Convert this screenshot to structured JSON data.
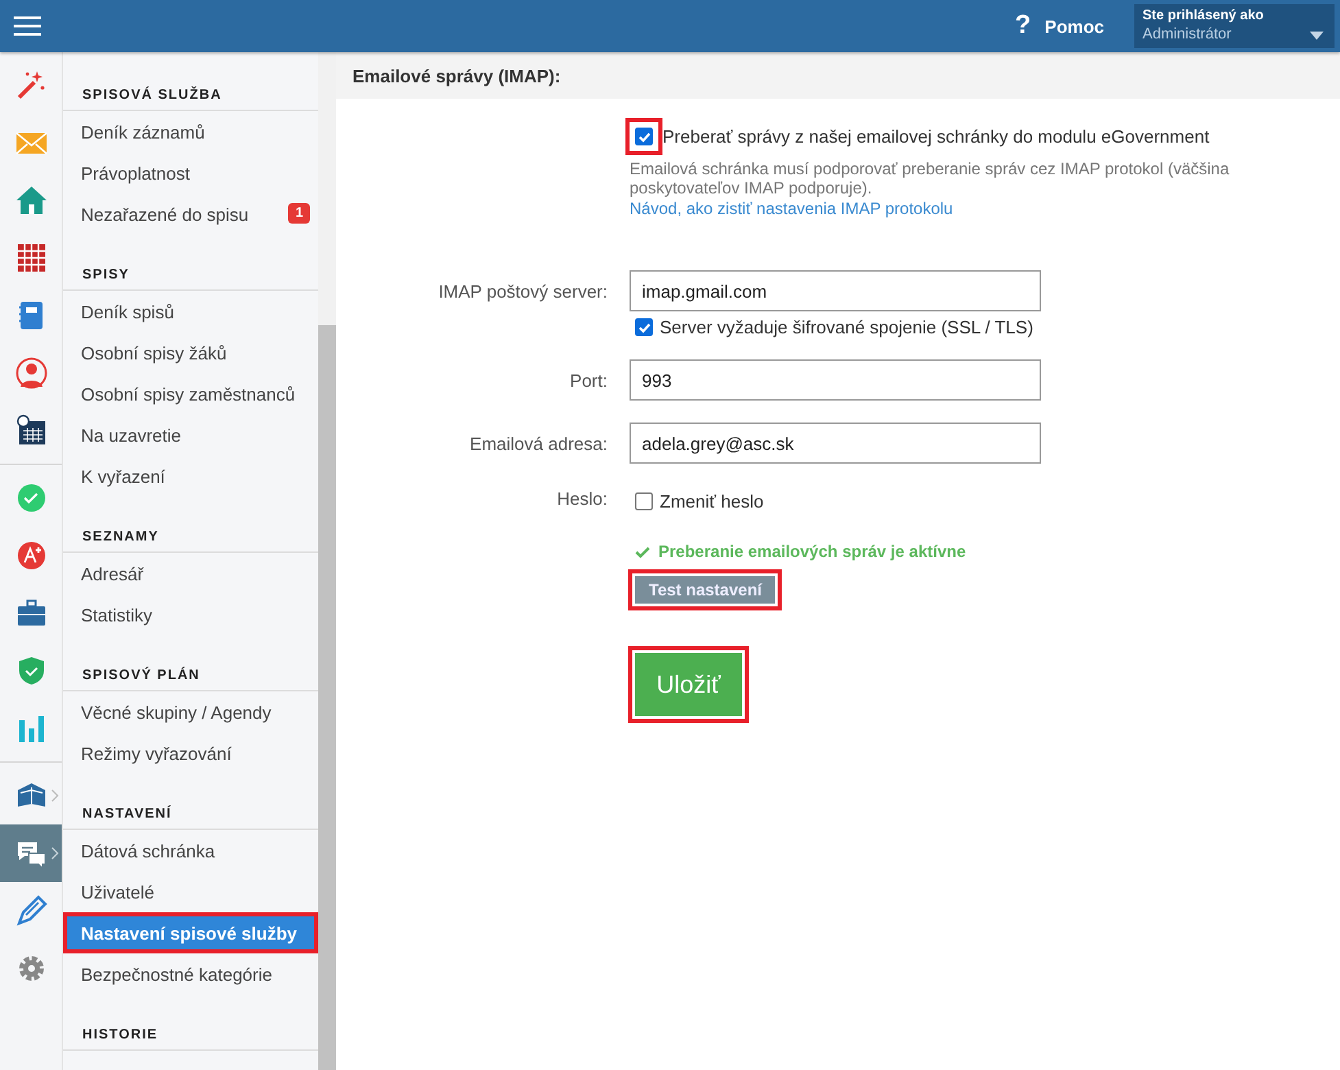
{
  "topbar": {
    "help_icon": "?",
    "help": "Pomoc",
    "user_caption": "Ste prihlásený ako",
    "user_role": "Administrátor"
  },
  "rail": {
    "groups": [
      [
        {
          "selected": false,
          "submenu": false
        },
        {
          "selected": false,
          "submenu": false
        },
        {
          "selected": false,
          "submenu": false
        },
        {
          "selected": false,
          "submenu": false
        },
        {
          "selected": false,
          "submenu": false
        },
        {
          "selected": false,
          "submenu": false
        },
        {
          "selected": false,
          "submenu": false
        }
      ],
      [
        {
          "selected": false,
          "submenu": false
        },
        {
          "selected": false,
          "submenu": false
        },
        {
          "selected": false,
          "submenu": false
        },
        {
          "selected": false,
          "submenu": false
        },
        {
          "selected": false,
          "submenu": false
        }
      ],
      [
        {
          "selected": false,
          "submenu": true
        },
        {
          "selected": true,
          "submenu": true
        },
        {
          "selected": false,
          "submenu": false
        },
        {
          "selected": false,
          "submenu": false
        }
      ]
    ]
  },
  "sidebar": {
    "sections": [
      {
        "title": "SPISOVÁ SLUŽBA",
        "items": [
          {
            "label": "Deník záznamů",
            "selected": false,
            "highlighted": false
          },
          {
            "label": "Právoplatnost",
            "selected": false,
            "highlighted": false
          },
          {
            "label": "Nezařazené do spisu",
            "selected": false,
            "highlighted": false,
            "badge": "1"
          }
        ]
      },
      {
        "title": "SPISY",
        "items": [
          {
            "label": "Deník spisů",
            "selected": false,
            "highlighted": false
          },
          {
            "label": "Osobní spisy žáků",
            "selected": false,
            "highlighted": false
          },
          {
            "label": "Osobní spisy zaměstnanců",
            "selected": false,
            "highlighted": false
          },
          {
            "label": "Na uzavretie",
            "selected": false,
            "highlighted": false
          },
          {
            "label": "K vyřazení",
            "selected": false,
            "highlighted": false
          }
        ]
      },
      {
        "title": "SEZNAMY",
        "items": [
          {
            "label": "Adresář",
            "selected": false,
            "highlighted": false
          },
          {
            "label": "Statistiky",
            "selected": false,
            "highlighted": false
          }
        ]
      },
      {
        "title": "SPISOVÝ PLÁN",
        "items": [
          {
            "label": "Věcné skupiny / Agendy",
            "selected": false,
            "highlighted": false
          },
          {
            "label": "Režimy vyřazování",
            "selected": false,
            "highlighted": false
          }
        ]
      },
      {
        "title": "NASTAVENÍ",
        "items": [
          {
            "label": "Dátová schránka",
            "selected": false,
            "highlighted": false
          },
          {
            "label": "Uživatelé",
            "selected": false,
            "highlighted": false
          },
          {
            "label": "Nastavení spisové služby",
            "selected": true,
            "highlighted": true
          },
          {
            "label": "Bezpečnostné kategórie",
            "selected": false,
            "highlighted": false
          }
        ]
      },
      {
        "title": "HISTORIE"
      }
    ]
  },
  "form": {
    "title": "Emailové správy (IMAP):",
    "enable": {
      "label": "Preberať správy z našej emailovej schránky do modulu eGovernment",
      "checked": true,
      "highlighted": true
    },
    "note": "Emailová schránka musí podporovať preberanie správ cez IMAP protokol (väčšina poskytovateľov IMAP podporuje).",
    "link": "Návod, ako zistiť nastavenia IMAP protokolu",
    "fields": [
      {
        "kind": "text",
        "label": "IMAP poštový server:",
        "value": "imap.gmail.com",
        "option": {
          "label": "Server vyžaduje šifrované spojenie (SSL / TLS)",
          "checked": true
        }
      },
      {
        "kind": "text",
        "label": "Port:",
        "value": "993"
      },
      {
        "kind": "text",
        "label": "Emailová adresa:",
        "value": "adela.grey@asc.sk"
      },
      {
        "kind": "checkbox",
        "label": "Heslo:",
        "option": {
          "label": "Zmeniť heslo",
          "checked": false
        }
      }
    ],
    "status": "Preberanie emailových správ je aktívne",
    "test_button": {
      "label": "Test nastavení",
      "highlighted": true
    },
    "save_button": {
      "label": "Uložiť",
      "highlighted": true
    }
  }
}
